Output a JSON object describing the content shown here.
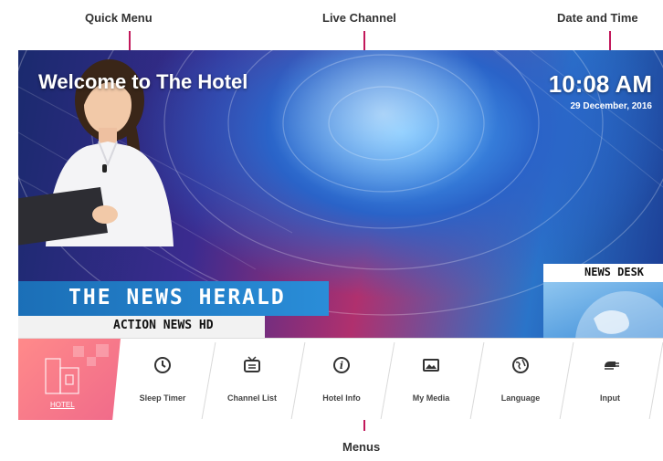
{
  "callouts": {
    "quick_menu": "Quick Menu",
    "live_channel": "Live Channel",
    "date_time": "Date and Time",
    "menus": "Menus"
  },
  "screen": {
    "welcome": "Welcome to The Hotel",
    "time": "10:08 AM",
    "date": "29 December, 2016",
    "news_title": "THE NEWS HERALD",
    "news_sub": "ACTION NEWS HD",
    "news_desk": "NEWS DESK"
  },
  "menu": {
    "hotel_label": "HOTEL",
    "items": [
      {
        "label": "Sleep Timer",
        "icon": "clock-icon"
      },
      {
        "label": "Channel List",
        "icon": "tv-list-icon"
      },
      {
        "label": "Hotel Info",
        "icon": "info-icon"
      },
      {
        "label": "My Media",
        "icon": "image-icon"
      },
      {
        "label": "Language",
        "icon": "globe-icon"
      },
      {
        "label": "Input",
        "icon": "plug-icon"
      }
    ]
  },
  "colors": {
    "accent": "#c2185b",
    "hotel_tile": "#f57a8a"
  }
}
